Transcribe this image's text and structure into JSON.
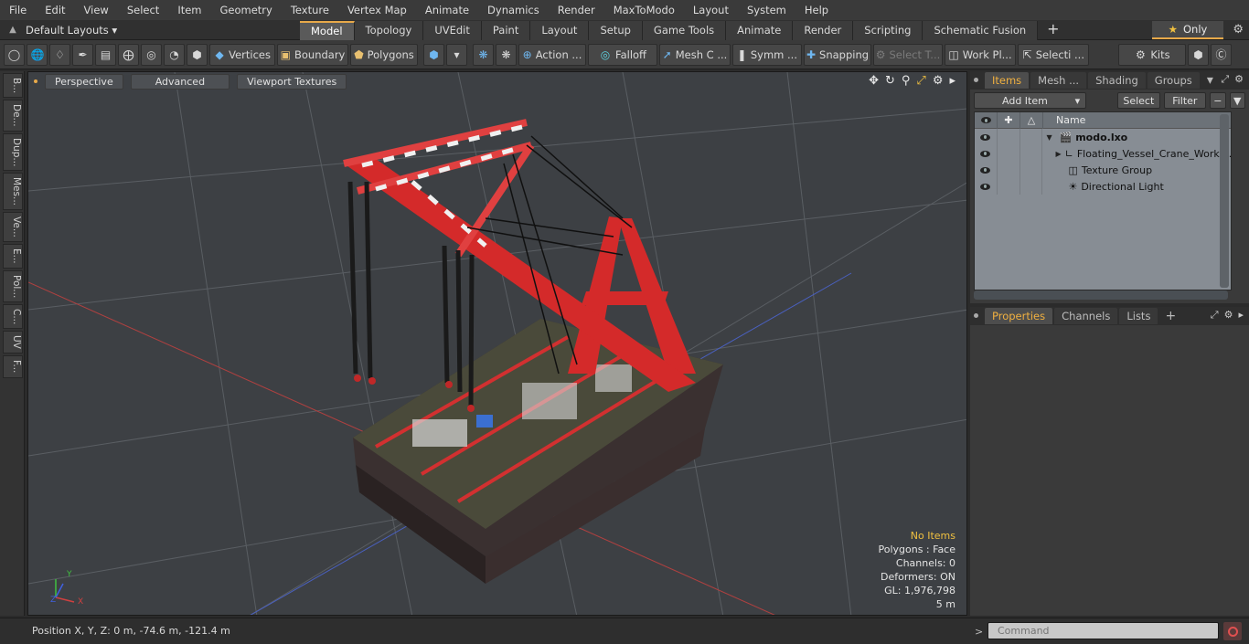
{
  "menu": [
    "File",
    "Edit",
    "View",
    "Select",
    "Item",
    "Geometry",
    "Texture",
    "Vertex Map",
    "Animate",
    "Dynamics",
    "Render",
    "MaxToModo",
    "Layout",
    "System",
    "Help"
  ],
  "layout": {
    "selector": "Default Layouts ▾",
    "tabs": [
      "Model",
      "Topology",
      "UVEdit",
      "Paint",
      "Layout",
      "Setup",
      "Game Tools",
      "Animate",
      "Render",
      "Scripting",
      "Schematic Fusion"
    ],
    "active_tab": "Model",
    "plus": "+",
    "only_label": "Only"
  },
  "toolbar": {
    "vertices": "Vertices",
    "boundary": "Boundary",
    "polygons": "Polygons",
    "action": "Action ...",
    "falloff": "Falloff",
    "mesh_c": "Mesh C ...",
    "symm": "Symm ...",
    "snapping": "Snapping",
    "select_t": "Select T...",
    "work_pl": "Work Pl...",
    "selecti": "Selecti ...",
    "kits": "Kits"
  },
  "left_tabs": [
    "B...",
    "De...",
    "Dup...",
    "Mes...",
    "Ve...",
    "E...",
    "Pol...",
    "C...",
    "UV",
    "F..."
  ],
  "viewport": {
    "perspective": "Perspective",
    "advanced": "Advanced",
    "viewport_textures": "Viewport Textures",
    "info": {
      "no_items": "No Items",
      "polygons": "Polygons : Face",
      "channels": "Channels: 0",
      "deformers": "Deformers: ON",
      "gl": "GL: 1,976,798",
      "scale": "5 m"
    },
    "axis": {
      "x": "X",
      "y": "Y",
      "z": "Z"
    }
  },
  "items_panel": {
    "tabs": [
      "Items",
      "Mesh ...",
      "Shading",
      "Groups"
    ],
    "active_tab": "Items",
    "add_item": "Add Item",
    "select": "Select",
    "filter": "Filter",
    "column_name": "Name",
    "rows": [
      {
        "name": "modo.lxo",
        "bold": true
      },
      {
        "name": "Floating_Vessel_Crane_Worki..."
      },
      {
        "name": "Texture Group"
      },
      {
        "name": "Directional Light"
      }
    ]
  },
  "properties_panel": {
    "tabs": [
      "Properties",
      "Channels",
      "Lists"
    ],
    "active_tab": "Properties",
    "plus": "+"
  },
  "status": {
    "position": "Position X, Y, Z:  0 m, -74.6 m, -121.4 m",
    "command_placeholder": "Command",
    "arrow": ">"
  }
}
